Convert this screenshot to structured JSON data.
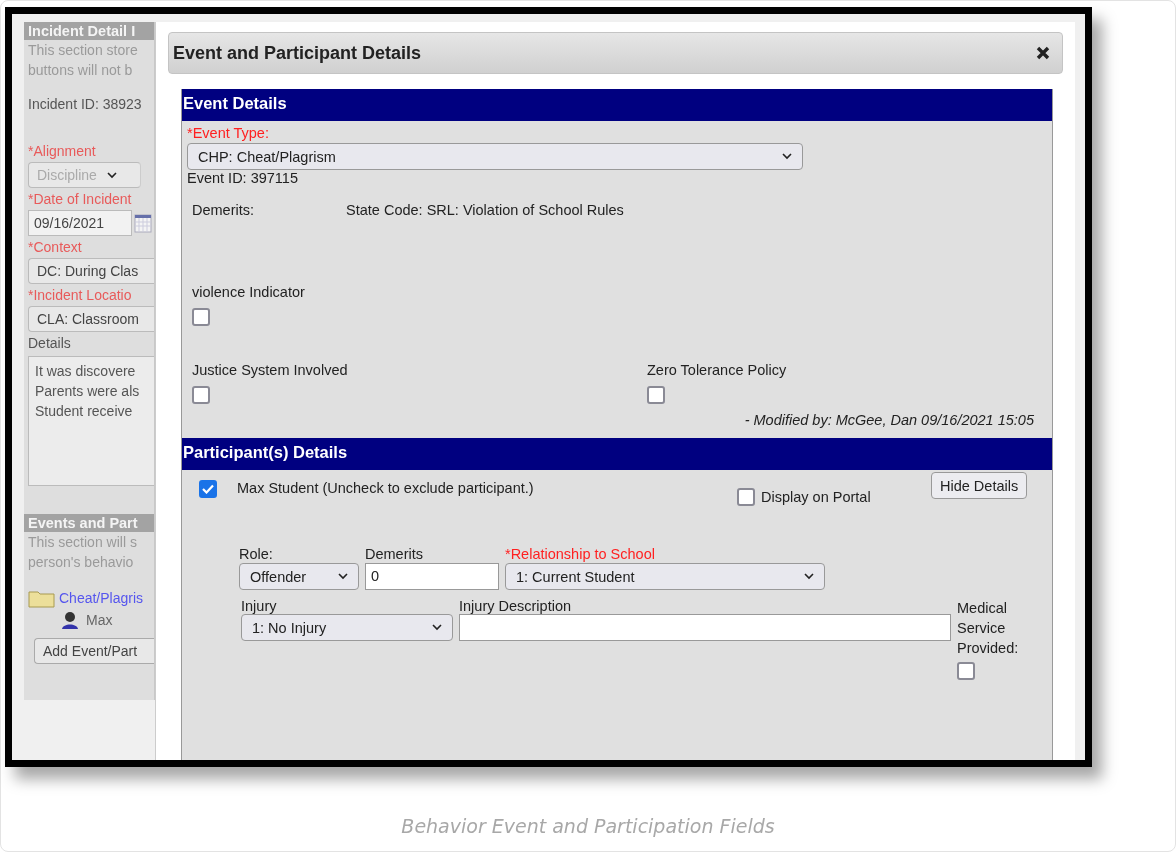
{
  "background_panel": {
    "items": [
      {
        "kind": "header",
        "text": "Incident Detail I"
      },
      {
        "kind": "note",
        "text": "This section store"
      },
      {
        "kind": "note",
        "text": "buttons will not b"
      },
      {
        "kind": "info",
        "text": "Incident ID: 38923"
      },
      {
        "kind": "required",
        "text": "*Alignment"
      },
      {
        "kind": "select",
        "text": "Discipline",
        "disabled": true
      },
      {
        "kind": "required",
        "text": "*Date of Incident"
      },
      {
        "kind": "date",
        "text": "09/16/2021"
      },
      {
        "kind": "required",
        "text": "*Context"
      },
      {
        "kind": "field",
        "text": "DC: During Clas"
      },
      {
        "kind": "required",
        "text": "*Incident Locatio"
      },
      {
        "kind": "field",
        "text": "CLA: Classroom"
      },
      {
        "kind": "label",
        "text": "Details"
      },
      {
        "kind": "textarea",
        "lines": [
          "It was discovere",
          "Parents were als",
          "Student receive"
        ]
      },
      {
        "kind": "header",
        "text": "Events and Part"
      },
      {
        "kind": "note",
        "text": "This section will s"
      },
      {
        "kind": "note",
        "text": "person's behavio"
      },
      {
        "kind": "folder",
        "text": "Cheat/Plagris"
      },
      {
        "kind": "person",
        "text": "Max"
      },
      {
        "kind": "button",
        "text": "Add Event/Part"
      }
    ]
  },
  "modal": {
    "title": "Event and Participant Details",
    "event_details": {
      "header": "Event Details",
      "event_type_label": "*Event Type:",
      "event_type_value": "CHP: Cheat/Plagrism",
      "event_id": "Event ID: 397115",
      "demerits_label": "Demerits:",
      "state_code": "State Code: SRL: Violation of School Rules",
      "violence_indicator": {
        "label": "violence Indicator",
        "checked": false
      },
      "justice_system": {
        "label": "Justice System Involved",
        "checked": false
      },
      "zero_tolerance": {
        "label": "Zero Tolerance Policy",
        "checked": false
      },
      "modified": "- Modified by: McGee, Dan 09/16/2021 15:05"
    },
    "participants": {
      "header": "Participant(s) Details",
      "participant": {
        "label": "Max Student (Uncheck to exclude participant.)",
        "checked": true
      },
      "display_on_portal": {
        "label": "Display on Portal",
        "checked": false
      },
      "hide_details_button": "Hide Details",
      "role_label": "Role:",
      "role_value": "Offender",
      "demerits_label": "Demerits",
      "demerits_value": "0",
      "relationship_label": "*Relationship to School",
      "relationship_value": "1: Current Student",
      "injury_label": "Injury",
      "injury_value": "1: No Injury",
      "injury_description_label": "Injury Description",
      "medical_label": "Medical Service Provided:",
      "medical_checked": false
    }
  },
  "caption": "Behavior Event and Participation Fields"
}
